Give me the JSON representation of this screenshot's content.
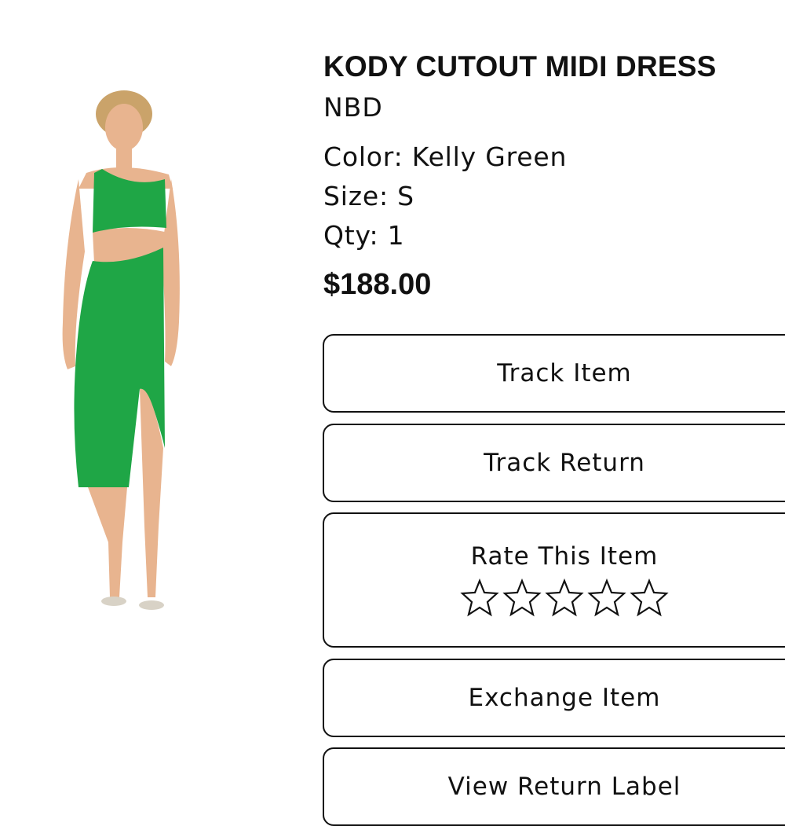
{
  "product": {
    "title": "KODY CUTOUT MIDI DRESS",
    "brand": "NBD",
    "color_line": "Color: Kelly Green",
    "size_line": "Size: S",
    "qty_line": "Qty: 1",
    "price": "$188.00",
    "dress_color": "#1fa646",
    "skin_color": "#e8b48f",
    "hair_color": "#caa36a"
  },
  "actions": {
    "track_item": "Track Item",
    "track_return": "Track Return",
    "rate_item": "Rate This Item",
    "rating_stars": 5,
    "rating_value": 0,
    "exchange_item": "Exchange Item",
    "view_return_label": "View Return Label"
  },
  "icons": {
    "star": "star-outline-icon"
  }
}
